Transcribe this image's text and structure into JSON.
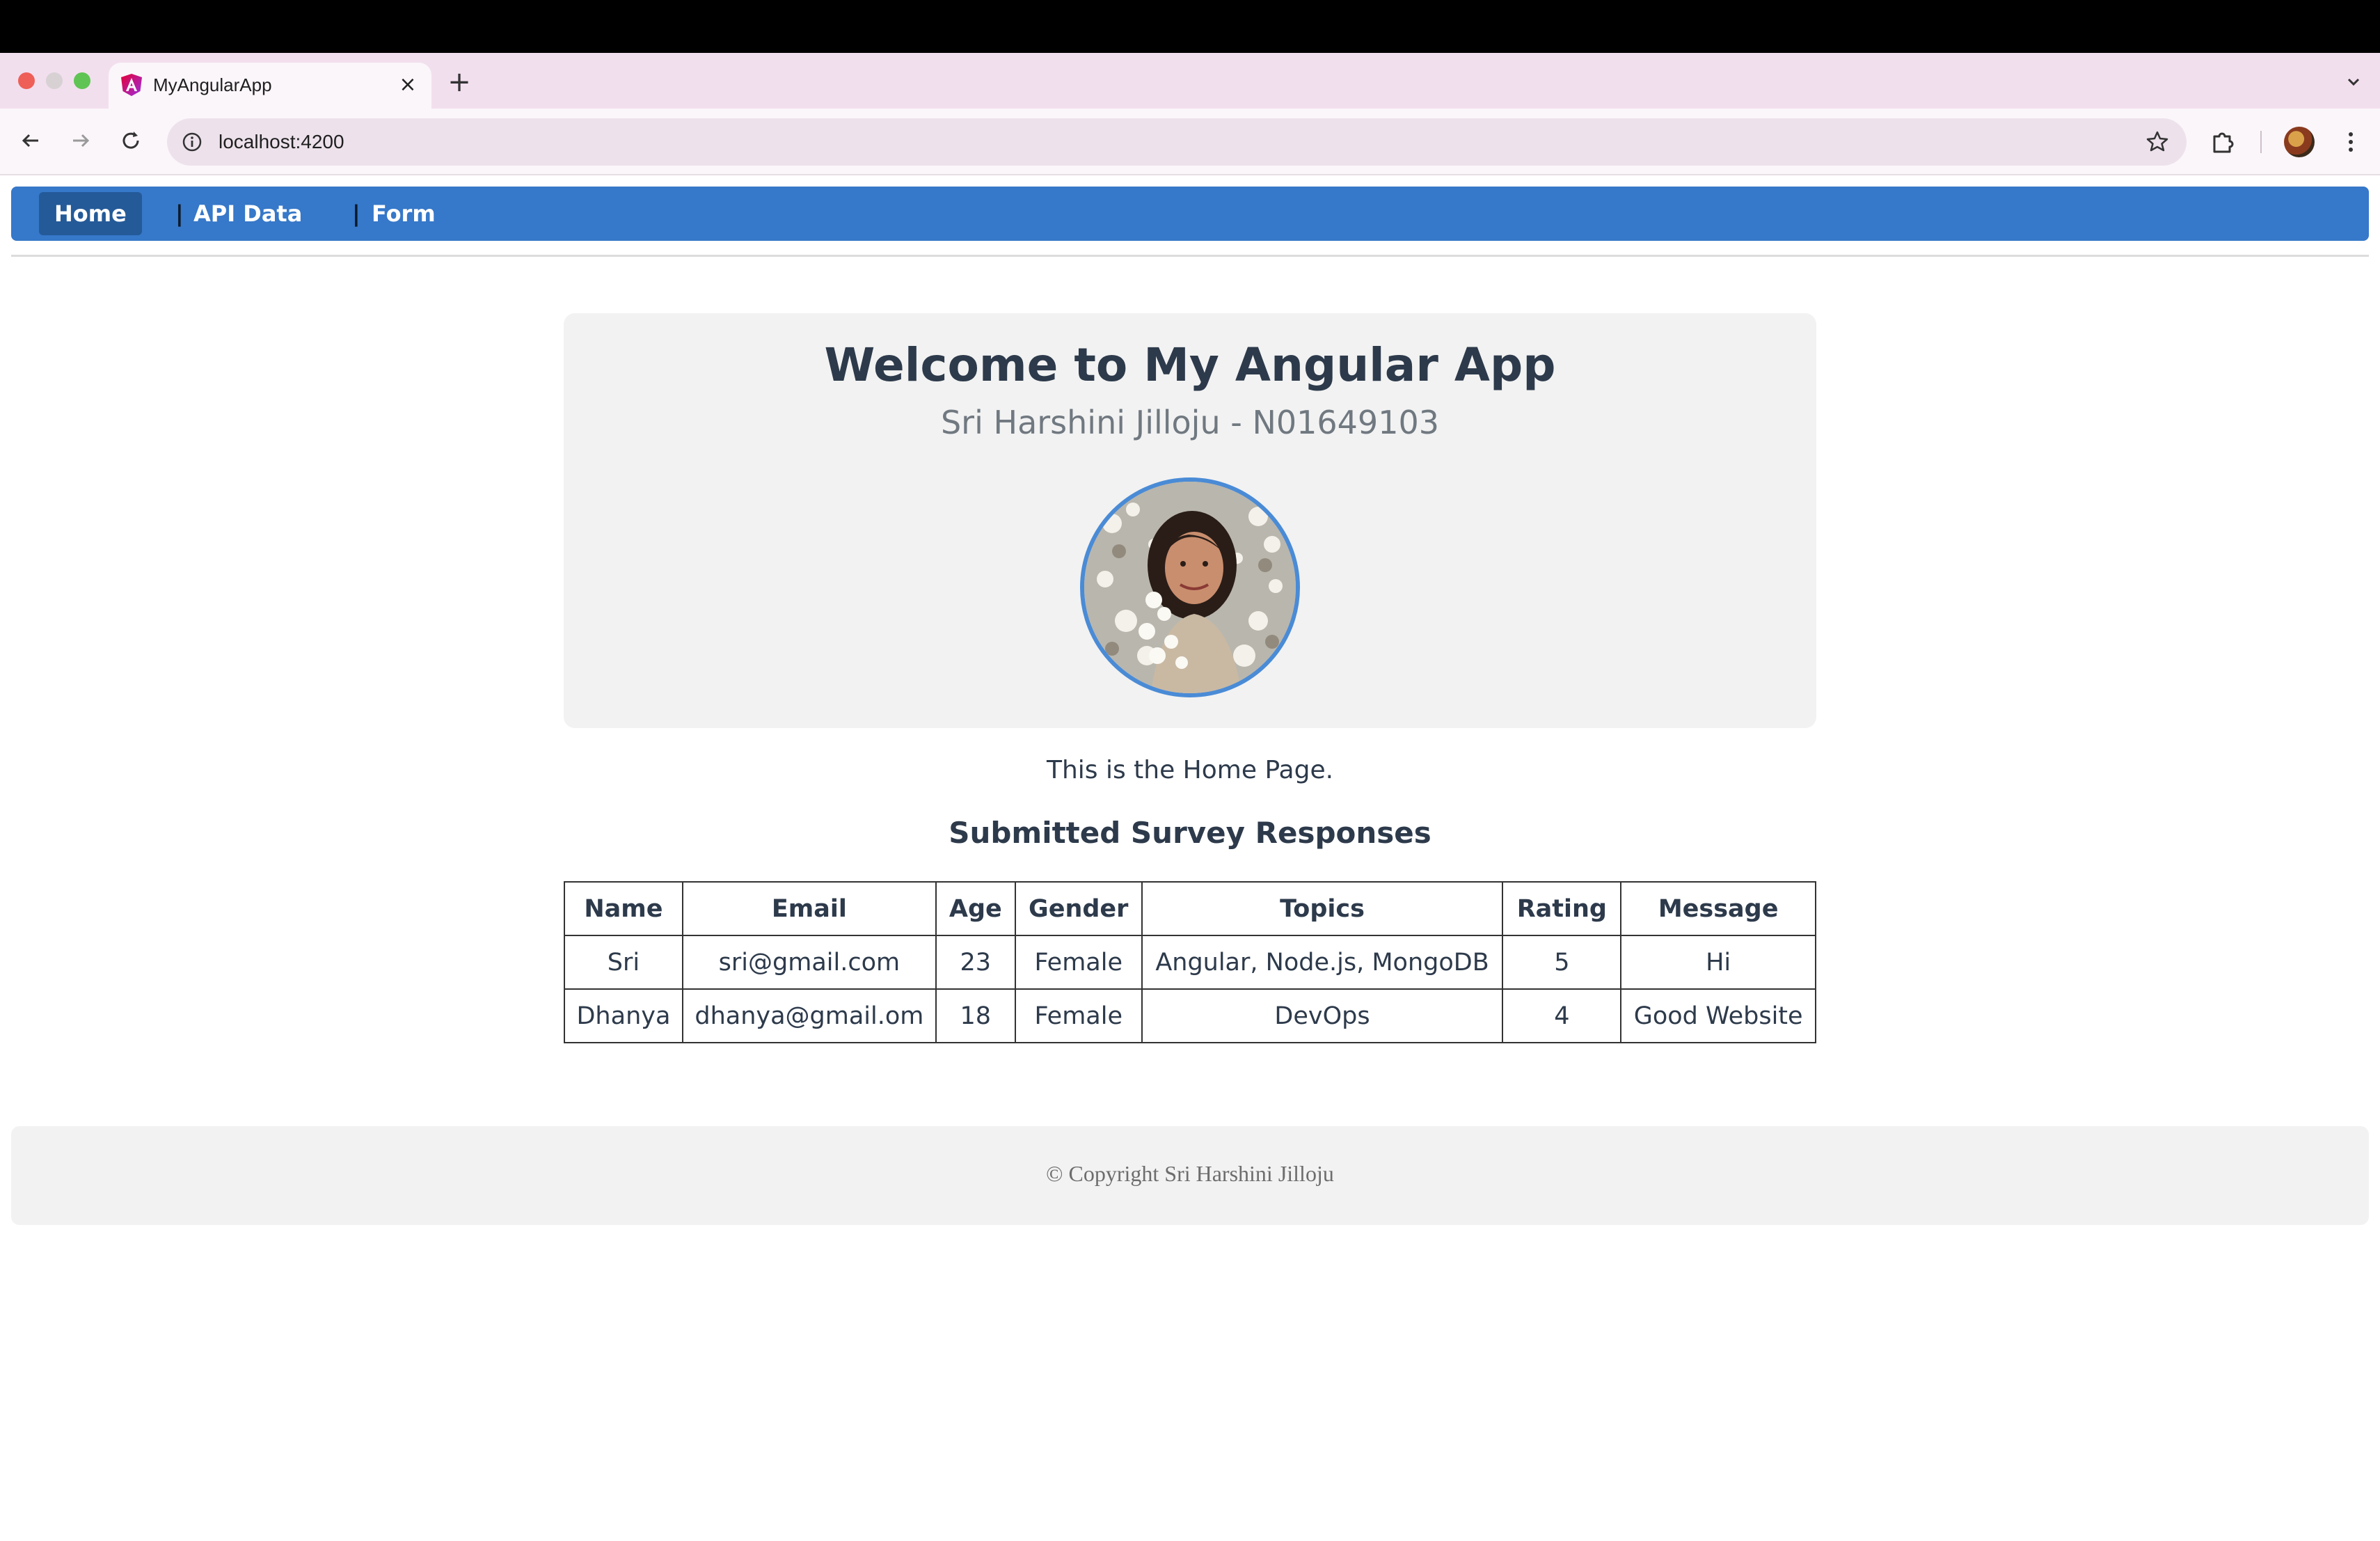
{
  "browser": {
    "tab_title": "MyAngularApp",
    "url": "localhost:4200",
    "icons": {
      "back": "arrow-left-icon",
      "forward": "arrow-right-icon",
      "reload": "reload-icon",
      "info": "info-icon",
      "star": "star-icon",
      "extensions": "puzzle-icon",
      "menu": "kebab-icon",
      "tab_close": "close-icon",
      "new_tab": "plus-icon",
      "tab_list": "chevron-down-icon"
    },
    "close_glyph": "×",
    "new_tab_glyph": "+",
    "tab_list_glyph": "⌄"
  },
  "nav": {
    "home": "Home",
    "api": "API Data",
    "form": "Form",
    "separator": "|",
    "accent": "#3678c9"
  },
  "hero": {
    "title": "Welcome to My Angular App",
    "subtitle": "Sri Harshini Jilloju - N01649103"
  },
  "home_text": "This is the Home Page.",
  "survey": {
    "title": "Submitted Survey Responses",
    "headers": [
      "Name",
      "Email",
      "Age",
      "Gender",
      "Topics",
      "Rating",
      "Message"
    ],
    "rows": [
      [
        "Sri",
        "sri@gmail.com",
        "23",
        "Female",
        "Angular, Node.js, MongoDB",
        "5",
        "Hi"
      ],
      [
        "Dhanya",
        "dhanya@gmail.om",
        "18",
        "Female",
        "DevOps",
        "4",
        "Good Website"
      ]
    ]
  },
  "footer": {
    "text": "© Copyright Sri Harshini Jilloju"
  }
}
